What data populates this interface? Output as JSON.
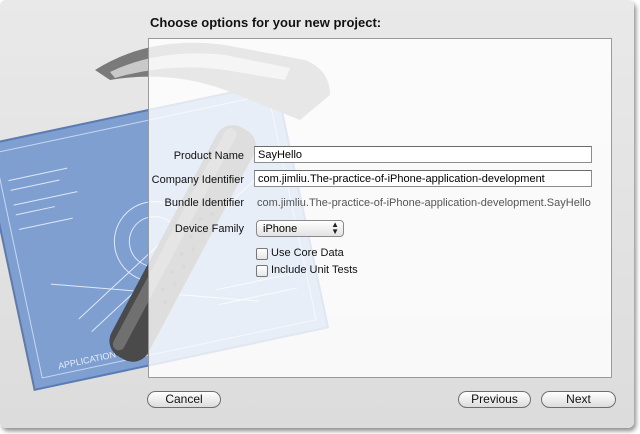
{
  "heading": "Choose options for your new project:",
  "form": {
    "product_name_label": "Product Name",
    "product_name_value": "SayHello",
    "company_identifier_label": "Company Identifier",
    "company_identifier_value": "com.jimliu.The-practice-of-iPhone-application-development",
    "bundle_identifier_label": "Bundle Identifier",
    "bundle_identifier_value": "com.jimliu.The-practice-of-iPhone-application-development.SayHello",
    "device_family_label": "Device Family",
    "device_family_value": "iPhone",
    "use_core_data_label": "Use Core Data",
    "use_core_data_checked": false,
    "include_unit_tests_label": "Include Unit Tests",
    "include_unit_tests_checked": false
  },
  "buttons": {
    "cancel": "Cancel",
    "previous": "Previous",
    "next": "Next"
  },
  "icons": {
    "background_art": "xcode-hammer-blueprint-icon",
    "select_arrows": "up-down-arrows-icon"
  },
  "colors": {
    "blueprint": "#7f9fd0",
    "window_bg": "#e3e3e3"
  }
}
